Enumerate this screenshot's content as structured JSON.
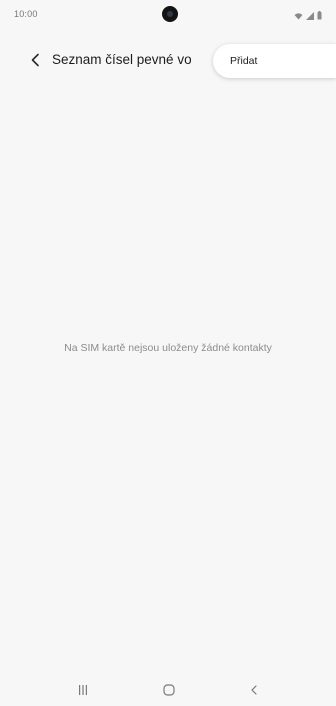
{
  "status_bar": {
    "time": "10:00",
    "icons": [
      "wifi-icon",
      "signal-icon",
      "battery-icon"
    ]
  },
  "header": {
    "title": "Seznam čísel pevné vo",
    "back_icon": "chevron-left-icon"
  },
  "menu": {
    "add_label": "Přidat"
  },
  "main": {
    "empty_message": "Na SIM kartě nejsou uloženy žádné kontakty"
  },
  "nav_bar": {
    "icons": [
      "recent-apps-icon",
      "home-icon",
      "back-icon"
    ]
  },
  "colors": {
    "background": "#f7f7f7",
    "menu_background": "#ffffff",
    "text_primary": "#1c1c1c",
    "text_secondary": "#8c8c8c"
  }
}
